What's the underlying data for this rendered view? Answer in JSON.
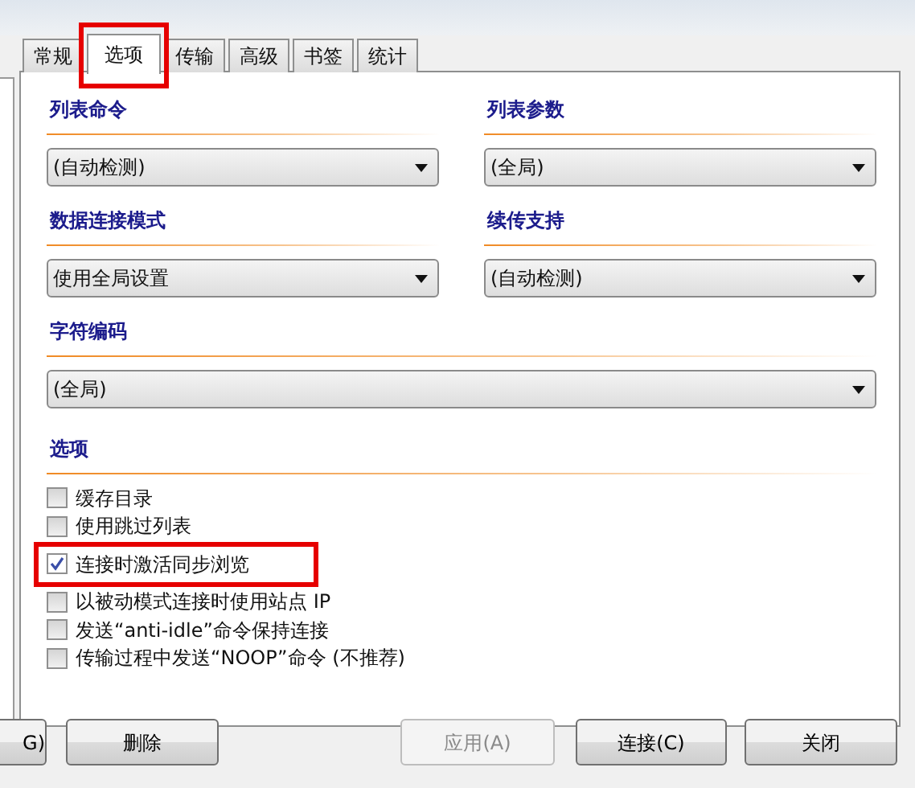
{
  "tabs": [
    {
      "label": "常规",
      "selected": false,
      "highlighted": false
    },
    {
      "label": "选项",
      "selected": true,
      "highlighted": true
    },
    {
      "label": "传输",
      "selected": false,
      "highlighted": false
    },
    {
      "label": "高级",
      "selected": false,
      "highlighted": false
    },
    {
      "label": "书签",
      "selected": false,
      "highlighted": false
    },
    {
      "label": "统计",
      "selected": false,
      "highlighted": false
    }
  ],
  "fields": [
    {
      "label": "列表命令",
      "value": "(自动检测)"
    },
    {
      "label": "列表参数",
      "value": "(全局)"
    },
    {
      "label": "数据连接模式",
      "value": "使用全局设置"
    },
    {
      "label": "续传支持",
      "value": "(自动检测)"
    },
    {
      "label": "字符编码",
      "value": "(全局)"
    }
  ],
  "options": {
    "title": "选项",
    "items": [
      {
        "label": "缓存目录",
        "checked": false,
        "highlighted": false
      },
      {
        "label": "使用跳过列表",
        "checked": false,
        "highlighted": false
      },
      {
        "label": "连接时激活同步浏览",
        "checked": true,
        "highlighted": true
      },
      {
        "label": "以被动模式连接时使用站点 IP",
        "checked": false,
        "highlighted": false
      },
      {
        "label": "发送“anti-idle”命令保持连接",
        "checked": false,
        "highlighted": false
      },
      {
        "label": "传输过程中发送“NOOP”命令 (不推荐)",
        "checked": false,
        "highlighted": false
      }
    ]
  },
  "buttons": [
    {
      "label": "G)",
      "disabled": false
    },
    {
      "label": "删除",
      "disabled": false
    },
    {
      "label": "应用(A)",
      "disabled": true
    },
    {
      "label": "连接(C)",
      "disabled": false
    },
    {
      "label": "关闭",
      "disabled": false
    }
  ]
}
